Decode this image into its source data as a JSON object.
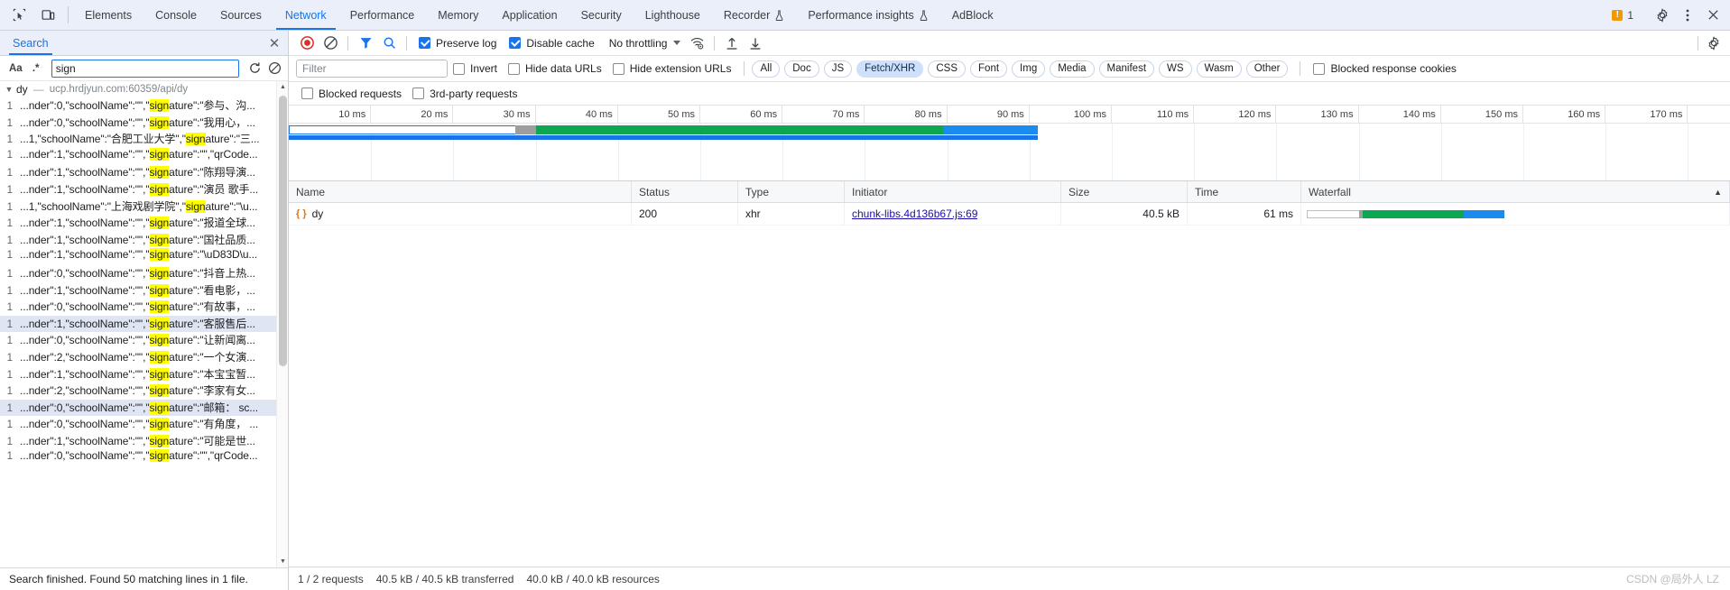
{
  "tabbar": {
    "icons": [
      {
        "name": "inspect-element-icon",
        "title": "Inspect"
      },
      {
        "name": "device-toolbar-icon",
        "title": "Toggle device toolbar"
      }
    ],
    "tabs": [
      {
        "label": "Elements",
        "active": false,
        "experimental": false
      },
      {
        "label": "Console",
        "active": false,
        "experimental": false
      },
      {
        "label": "Sources",
        "active": false,
        "experimental": false
      },
      {
        "label": "Network",
        "active": true,
        "experimental": false
      },
      {
        "label": "Performance",
        "active": false,
        "experimental": false
      },
      {
        "label": "Memory",
        "active": false,
        "experimental": false
      },
      {
        "label": "Application",
        "active": false,
        "experimental": false
      },
      {
        "label": "Security",
        "active": false,
        "experimental": false
      },
      {
        "label": "Lighthouse",
        "active": false,
        "experimental": false
      },
      {
        "label": "Recorder",
        "active": false,
        "experimental": true
      },
      {
        "label": "Performance insights",
        "active": false,
        "experimental": true
      },
      {
        "label": "AdBlock",
        "active": false,
        "experimental": false
      }
    ],
    "warning_count": "1",
    "warning_glyph": "!",
    "settings_label": "gear-icon",
    "more_label": "more-options-icon",
    "close_label": "close-icon"
  },
  "search_pane": {
    "tab_label": "Search",
    "close_glyph": "✕",
    "toolbar": {
      "match_case_label": "Aa",
      "regex_label": ".*",
      "query_value": "sign",
      "query_placeholder": "",
      "refresh_glyph": "↻",
      "clear_glyph": "⃠"
    },
    "file": {
      "caret": "▼",
      "name": "dy",
      "dash": "—",
      "url": "ucp.hrdjyun.com:60359/api/dy"
    },
    "results": [
      {
        "line": "1",
        "pre": "...nder\":0,\"schoolName\":\"\",\"",
        "hl": "sign",
        "post": "ature\":\"参与、沟...",
        "selected": false
      },
      {
        "line": "1",
        "pre": "...nder\":0,\"schoolName\":\"\",\"",
        "hl": "sign",
        "post": "ature\":\"我用心，...",
        "selected": false
      },
      {
        "line": "1",
        "pre": "...1,\"schoolName\":\"合肥工业大学\",\"",
        "hl": "sign",
        "post": "ature\":\"三...",
        "selected": false
      },
      {
        "line": "1",
        "pre": "...nder\":1,\"schoolName\":\"\",\"",
        "hl": "sign",
        "post": "ature\":\"\",\"qrCode...",
        "selected": false
      },
      {
        "line": "1",
        "pre": "...nder\":1,\"schoolName\":\"\",\"",
        "hl": "sign",
        "post": "ature\":\"陈翔导演...",
        "selected": false
      },
      {
        "line": "1",
        "pre": "...nder\":1,\"schoolName\":\"\",\"",
        "hl": "sign",
        "post": "ature\":\"演员 歌手...",
        "selected": false
      },
      {
        "line": "1",
        "pre": "...1,\"schoolName\":\"上海戏剧学院\",\"",
        "hl": "sign",
        "post": "ature\":\"\\u...",
        "selected": false
      },
      {
        "line": "1",
        "pre": "...nder\":1,\"schoolName\":\"\",\"",
        "hl": "sign",
        "post": "ature\":\"报道全球...",
        "selected": false
      },
      {
        "line": "1",
        "pre": "...nder\":1,\"schoolName\":\"\",\"",
        "hl": "sign",
        "post": "ature\":\"国社品质...",
        "selected": false
      },
      {
        "line": "1",
        "pre": "...nder\":1,\"schoolName\":\"\",\"",
        "hl": "sign",
        "post": "ature\":\"\\uD83D\\u...",
        "selected": false
      },
      {
        "line": "1",
        "pre": "...nder\":0,\"schoolName\":\"\",\"",
        "hl": "sign",
        "post": "ature\":\"抖音上热...",
        "selected": false
      },
      {
        "line": "1",
        "pre": "...nder\":1,\"schoolName\":\"\",\"",
        "hl": "sign",
        "post": "ature\":\"看电影，...",
        "selected": false
      },
      {
        "line": "1",
        "pre": "...nder\":0,\"schoolName\":\"\",\"",
        "hl": "sign",
        "post": "ature\":\"有故事，...",
        "selected": false
      },
      {
        "line": "1",
        "pre": "...nder\":1,\"schoolName\":\"\",\"",
        "hl": "sign",
        "post": "ature\":\"客服售后...",
        "selected": true
      },
      {
        "line": "1",
        "pre": "...nder\":0,\"schoolName\":\"\",\"",
        "hl": "sign",
        "post": "ature\":\"让新闻离...",
        "selected": false
      },
      {
        "line": "1",
        "pre": "...nder\":2,\"schoolName\":\"\",\"",
        "hl": "sign",
        "post": "ature\":\"一个女演...",
        "selected": false
      },
      {
        "line": "1",
        "pre": "...nder\":1,\"schoolName\":\"\",\"",
        "hl": "sign",
        "post": "ature\":\"本宝宝暂...",
        "selected": false
      },
      {
        "line": "1",
        "pre": "...nder\":2,\"schoolName\":\"\",\"",
        "hl": "sign",
        "post": "ature\":\"李家有女...",
        "selected": false
      },
      {
        "line": "1",
        "pre": "...nder\":0,\"schoolName\":\"\",\"",
        "hl": "sign",
        "post": "ature\":\"邮箱： sc...",
        "selected": true
      },
      {
        "line": "1",
        "pre": "...nder\":0,\"schoolName\":\"\",\"",
        "hl": "sign",
        "post": "ature\":\"有角度， ...",
        "selected": false
      },
      {
        "line": "1",
        "pre": "...nder\":1,\"schoolName\":\"\",\"",
        "hl": "sign",
        "post": "ature\":\"可能是世...",
        "selected": false
      },
      {
        "line": "1",
        "pre": "...nder\":0,\"schoolName\":\"\",\"",
        "hl": "sign",
        "post": "ature\":\"\",\"qrCode...",
        "selected": false
      }
    ],
    "scroll_up_glyph": "▲",
    "scroll_down_glyph": "▼",
    "status": "Search finished. Found 50 matching lines in 1 file."
  },
  "network_toolbar": {
    "record_title": "record-button",
    "clear_title": "clear-button",
    "filter_title": "filter-icon",
    "search_title": "search-icon",
    "preserve_log": {
      "label": "Preserve log",
      "checked": true
    },
    "disable_cache": {
      "label": "Disable cache",
      "checked": true
    },
    "throttling": "No throttling",
    "wifi_title": "network-conditions-icon",
    "import_title": "import-har-icon",
    "export_title": "export-har-icon",
    "settings_title": "network-settings-icon"
  },
  "filter_row": {
    "filter_placeholder": "Filter",
    "filter_value": "",
    "invert": {
      "label": "Invert",
      "checked": false
    },
    "hide_data_urls": {
      "label": "Hide data URLs",
      "checked": false
    },
    "hide_extension_urls": {
      "label": "Hide extension URLs",
      "checked": false
    },
    "type_chips": [
      {
        "label": "All",
        "active": false
      },
      {
        "label": "Doc",
        "active": false
      },
      {
        "label": "JS",
        "active": false
      },
      {
        "label": "Fetch/XHR",
        "active": true
      },
      {
        "label": "CSS",
        "active": false
      },
      {
        "label": "Font",
        "active": false
      },
      {
        "label": "Img",
        "active": false
      },
      {
        "label": "Media",
        "active": false
      },
      {
        "label": "Manifest",
        "active": false
      },
      {
        "label": "WS",
        "active": false
      },
      {
        "label": "Wasm",
        "active": false
      },
      {
        "label": "Other",
        "active": false
      }
    ],
    "blocked_response_cookies": {
      "label": "Blocked response cookies",
      "checked": false
    }
  },
  "filter_row2": {
    "blocked_requests": {
      "label": "Blocked requests",
      "checked": false
    },
    "third_party_requests": {
      "label": "3rd-party requests",
      "checked": false
    }
  },
  "overview": {
    "ticks": [
      "10 ms",
      "20 ms",
      "30 ms",
      "40 ms",
      "50 ms",
      "60 ms",
      "70 ms",
      "80 ms",
      "90 ms",
      "100 ms",
      "110 ms",
      "120 ms",
      "130 ms",
      "140 ms",
      "150 ms",
      "160 ms",
      "170 ms"
    ],
    "bar": {
      "stall_start_ms": 27.5,
      "stall_end_ms": 30.0,
      "green_end_ms": 79.5,
      "blue_end_ms": 91.0,
      "total_ms": 175
    }
  },
  "request_table": {
    "columns": [
      "Name",
      "Status",
      "Type",
      "Initiator",
      "Size",
      "Time",
      "Waterfall"
    ],
    "sort_arrow": "▲",
    "rows": [
      {
        "name": "dy",
        "icon": "json-icon",
        "icon_glyph": "{ }",
        "status": "200",
        "type": "xhr",
        "initiator": "chunk-libs.4d136b67.js:69",
        "size": "40.5 kB",
        "time": "61 ms"
      }
    ]
  },
  "statusbar": {
    "requests": "1 / 2 requests",
    "transferred": "40.5 kB / 40.5 kB transferred",
    "resources": "40.0 kB / 40.0 kB resources"
  },
  "watermark": "CSDN @局外人 LZ",
  "colors": {
    "accent": "#1a73e8",
    "tabbar_bg": "#ebeff9",
    "highlight": "#ffff00",
    "waterfall_green": "#0ca750",
    "waterfall_blue": "#1a8cf0",
    "waterfall_stall": "#9e9e9e",
    "chip_active_bg": "#cfe0fc",
    "warning": "#f29900"
  }
}
